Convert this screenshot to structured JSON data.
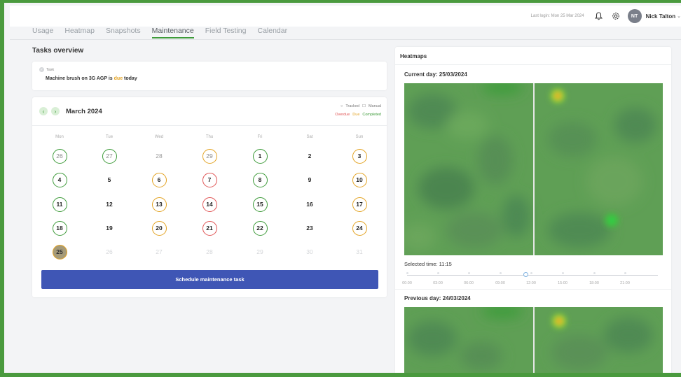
{
  "header": {
    "last_login": "Last login: Mon 25 Mar 2024",
    "bell_icon": "bell-icon",
    "settings_icon": "gear-icon",
    "avatar_initials": "NT",
    "user_name": "Nick Talton"
  },
  "tabs": [
    {
      "label": "Usage",
      "active": false
    },
    {
      "label": "Heatmap",
      "active": false
    },
    {
      "label": "Snapshots",
      "active": false
    },
    {
      "label": "Maintenance",
      "active": true
    },
    {
      "label": "Field Testing",
      "active": false
    },
    {
      "label": "Calendar",
      "active": false
    }
  ],
  "tasks_overview": {
    "title": "Tasks overview",
    "task_tag": "Task",
    "task_text_before": "Machine brush on 3G AGP is ",
    "task_status": "due",
    "task_text_after": " today"
  },
  "calendar": {
    "month_label": "March 2024",
    "legend_tracked": "Tracked",
    "legend_manual": "Manual",
    "legend_overdue": "Overdue",
    "legend_due": "Due",
    "legend_completed": "Completed",
    "weekdays": [
      "Mon",
      "Tue",
      "Wed",
      "Thu",
      "Fri",
      "Sat",
      "Sun"
    ],
    "weeks": [
      [
        {
          "d": "26",
          "s": "completed",
          "o": true
        },
        {
          "d": "27",
          "s": "completed",
          "o": true
        },
        {
          "d": "28",
          "s": "",
          "o": true
        },
        {
          "d": "29",
          "s": "due",
          "o": true
        },
        {
          "d": "1",
          "s": "completed"
        },
        {
          "d": "2",
          "s": ""
        },
        {
          "d": "3",
          "s": "due"
        }
      ],
      [
        {
          "d": "4",
          "s": "completed"
        },
        {
          "d": "5",
          "s": ""
        },
        {
          "d": "6",
          "s": "due"
        },
        {
          "d": "7",
          "s": "overdue"
        },
        {
          "d": "8",
          "s": "completed"
        },
        {
          "d": "9",
          "s": ""
        },
        {
          "d": "10",
          "s": "due"
        }
      ],
      [
        {
          "d": "11",
          "s": "completed"
        },
        {
          "d": "12",
          "s": ""
        },
        {
          "d": "13",
          "s": "due"
        },
        {
          "d": "14",
          "s": "overdue"
        },
        {
          "d": "15",
          "s": "completed"
        },
        {
          "d": "16",
          "s": ""
        },
        {
          "d": "17",
          "s": "due"
        }
      ],
      [
        {
          "d": "18",
          "s": "completed"
        },
        {
          "d": "19",
          "s": ""
        },
        {
          "d": "20",
          "s": "due"
        },
        {
          "d": "21",
          "s": "overdue"
        },
        {
          "d": "22",
          "s": "completed"
        },
        {
          "d": "23",
          "s": ""
        },
        {
          "d": "24",
          "s": "due"
        }
      ],
      [
        {
          "d": "25",
          "s": "today"
        },
        {
          "d": "26",
          "s": "faded"
        },
        {
          "d": "27",
          "s": "faded"
        },
        {
          "d": "28",
          "s": "faded"
        },
        {
          "d": "29",
          "s": "faded"
        },
        {
          "d": "30",
          "s": "faded"
        },
        {
          "d": "31",
          "s": "faded"
        }
      ]
    ],
    "schedule_button": "Schedule maintenance task"
  },
  "heatmaps": {
    "title": "Heatmaps",
    "current_day_label": "Current day: 25/03/2024",
    "selected_time": "Selected time: 11:15",
    "slider_ticks": [
      "00:00",
      "03:00",
      "06:00",
      "09:00",
      "12:00",
      "15:00",
      "18:00",
      "21:00"
    ],
    "slider_value_fraction": 0.47,
    "previous_day_label": "Previous day: 24/03/2024"
  },
  "colors": {
    "accent_green": "#3e9b3a",
    "due_orange": "#e3a323",
    "overdue_red": "#e05555",
    "button_blue": "#3f56b5"
  }
}
